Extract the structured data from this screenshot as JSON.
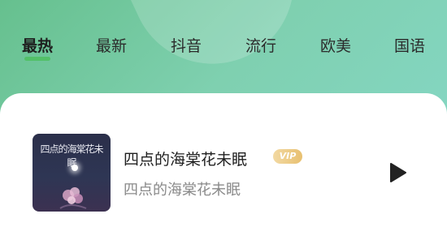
{
  "tabs": [
    {
      "label": "最热",
      "active": true
    },
    {
      "label": "最新",
      "active": false
    },
    {
      "label": "抖音",
      "active": false
    },
    {
      "label": "流行",
      "active": false
    },
    {
      "label": "欧美",
      "active": false
    },
    {
      "label": "国语",
      "active": false
    }
  ],
  "song": {
    "title": "四点的海棠花未眠",
    "badge": "VIP",
    "artist": "四点的海棠花未眠",
    "cover_text": "四点的海棠花未眠"
  },
  "icons": {
    "play": "play-icon"
  },
  "colors": {
    "accent": "#4fbf63",
    "badge": "#e8c070"
  }
}
